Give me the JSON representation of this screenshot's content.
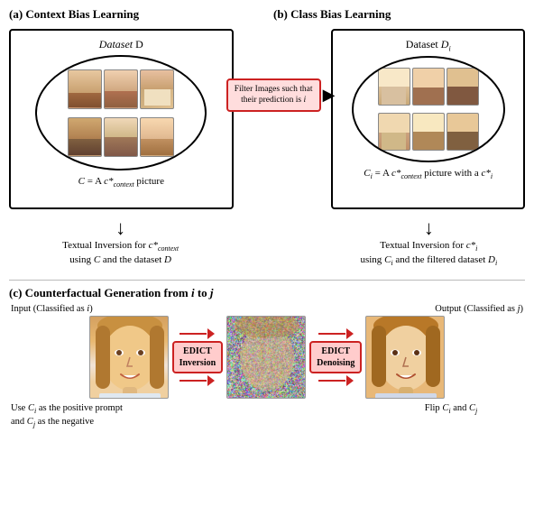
{
  "sections": {
    "a": {
      "label": "(a) Context Bias Learning",
      "dataset_label": "Dataset D",
      "caption": "C = A c*_context picture",
      "textual_inv_line1": "Textual Inversion for c*_context",
      "textual_inv_line2": "using C and the dataset D"
    },
    "b": {
      "label": "(b) Class Bias Learning",
      "dataset_label": "Dataset D_i",
      "caption": "C_i = A c*_context picture with a c*_i",
      "textual_inv_line1": "Textual Inversion for c*_i",
      "textual_inv_line2": "using C_i and the filtered dataset D_i"
    },
    "filter": {
      "text": "Filter Images such that their prediction is i"
    },
    "c": {
      "label": "(c) Counterfactual Generation from i to j",
      "input_label": "Input (Classified as i)",
      "output_label": "Output (Classified as j)",
      "edict_inversion": "EDICT\nInversion",
      "edict_denoising": "EDICT\nDenoising",
      "caption_left_line1": "Use C_i as the positive prompt",
      "caption_left_line2": "and C_j as the negative",
      "caption_right": "Flip C_i and C_j"
    }
  }
}
